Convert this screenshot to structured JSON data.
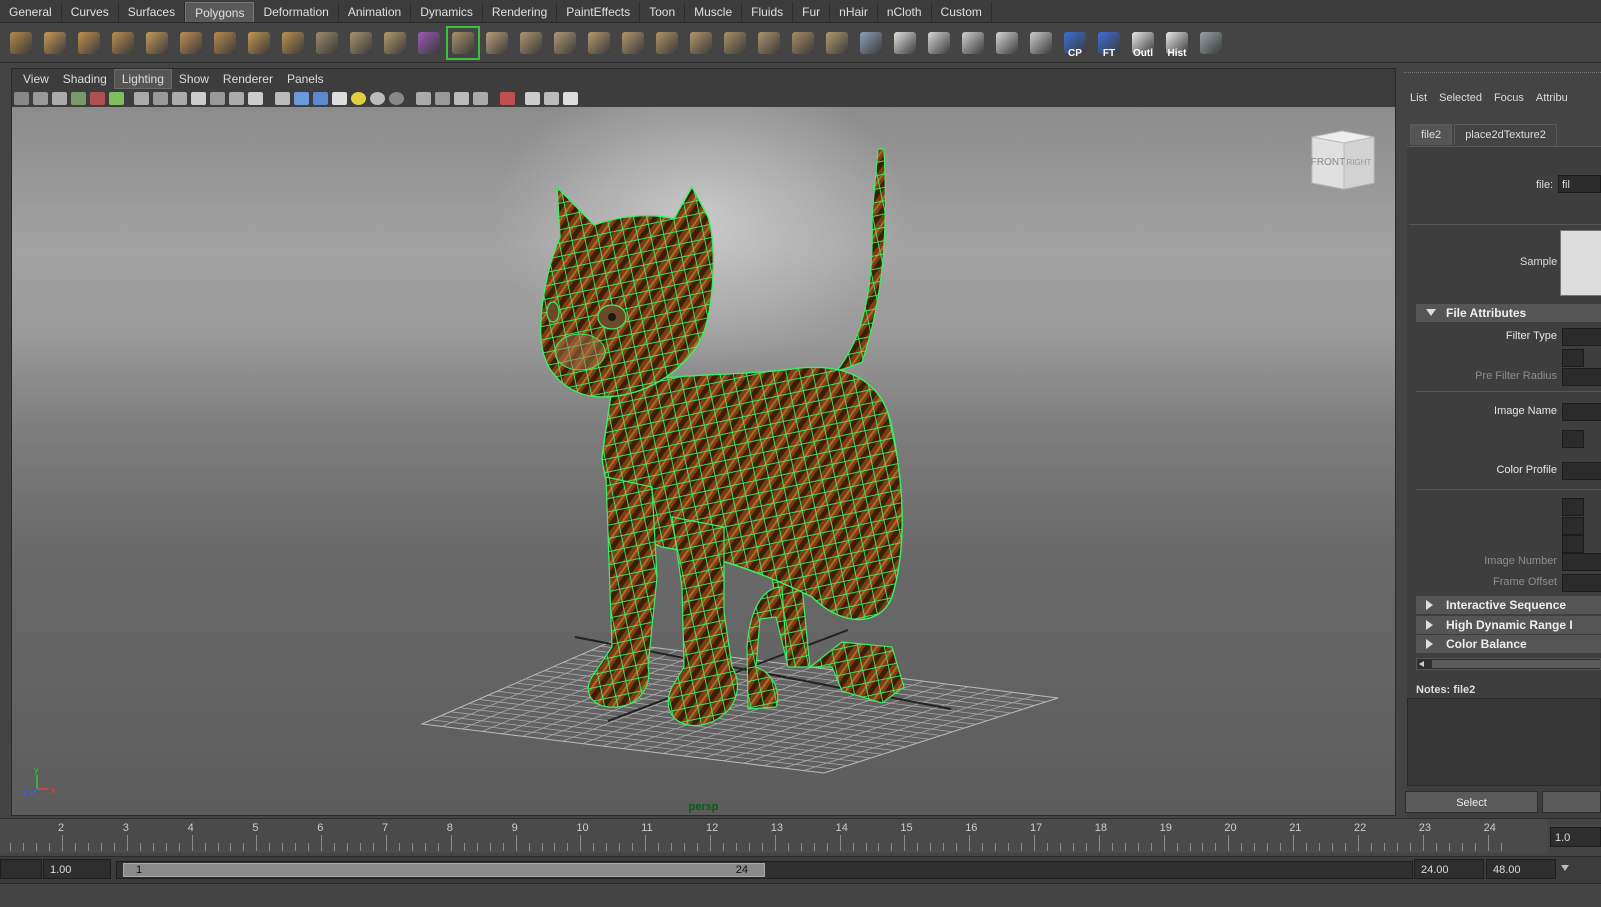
{
  "shelf": {
    "tabs": [
      {
        "label": "General",
        "active": false
      },
      {
        "label": "Curves",
        "active": false
      },
      {
        "label": "Surfaces",
        "active": false
      },
      {
        "label": "Polygons",
        "active": true
      },
      {
        "label": "Deformation",
        "active": false
      },
      {
        "label": "Animation",
        "active": false
      },
      {
        "label": "Dynamics",
        "active": false
      },
      {
        "label": "Rendering",
        "active": false
      },
      {
        "label": "PaintEffects",
        "active": false
      },
      {
        "label": "Toon",
        "active": false
      },
      {
        "label": "Muscle",
        "active": false
      },
      {
        "label": "Fluids",
        "active": false
      },
      {
        "label": "Fur",
        "active": false
      },
      {
        "label": "nHair",
        "active": false
      },
      {
        "label": "nCloth",
        "active": false
      },
      {
        "label": "Custom",
        "active": false
      }
    ],
    "icons": [
      {
        "name": "poly-sphere-icon",
        "color": "#b58a4a",
        "text": ""
      },
      {
        "name": "poly-cube-icon",
        "color": "#c89a55",
        "text": ""
      },
      {
        "name": "poly-cylinder-icon",
        "color": "#c0914c",
        "text": ""
      },
      {
        "name": "poly-cone-icon",
        "color": "#b88c4f",
        "text": ""
      },
      {
        "name": "poly-plane-icon",
        "color": "#c39a5a",
        "text": ""
      },
      {
        "name": "poly-torus-icon",
        "color": "#bf8e50",
        "text": ""
      },
      {
        "name": "poly-pyramid-icon",
        "color": "#b88a4d",
        "text": ""
      },
      {
        "name": "poly-pipe-icon",
        "color": "#c4964f",
        "text": ""
      },
      {
        "name": "poly-soccer-ball-icon",
        "color": "#bd914f",
        "text": ""
      },
      {
        "name": "combine-icon",
        "color": "#9a8a6a",
        "text": ""
      },
      {
        "name": "separate-icon",
        "color": "#a7946c",
        "text": ""
      },
      {
        "name": "smooth-icon",
        "color": "#b29a6a",
        "text": ""
      },
      {
        "name": "extrude-icon",
        "color": "#9b59b6",
        "text": ""
      },
      {
        "name": "bridge-icon",
        "color": "#a9906a",
        "text": ""
      },
      {
        "name": "append-polygon-icon",
        "color": "#b8a07a",
        "text": ""
      },
      {
        "name": "insert-edge-loop-icon",
        "color": "#ae9670",
        "text": ""
      },
      {
        "name": "split-polygon-icon",
        "color": "#b09a74",
        "text": ""
      },
      {
        "name": "bevel-icon",
        "color": "#b4996c",
        "text": ""
      },
      {
        "name": "merge-vertex-icon",
        "color": "#b2956a",
        "text": ""
      },
      {
        "name": "delete-edge-icon",
        "color": "#b09366",
        "text": ""
      },
      {
        "name": "fill-hole-icon",
        "color": "#b3976b",
        "text": ""
      },
      {
        "name": "planar-mapping-icon",
        "color": "#a88f66",
        "text": ""
      },
      {
        "name": "cylindrical-mapping-icon",
        "color": "#ad946a",
        "text": ""
      },
      {
        "name": "spherical-mapping-icon",
        "color": "#a78c64",
        "text": ""
      },
      {
        "name": "automatic-mapping-icon",
        "color": "#b29a70",
        "text": ""
      },
      {
        "name": "uv-snapshot-icon",
        "color": "#8da0b8",
        "text": ""
      },
      {
        "name": "checker-uv-icon",
        "color": "#e0e0e0",
        "text": ""
      },
      {
        "name": "checker-tile-icon",
        "color": "#d8d8d8",
        "text": ""
      },
      {
        "name": "checker-warp-icon",
        "color": "#d0d0d0",
        "text": ""
      },
      {
        "name": "checker-unfold-icon",
        "color": "#d5d5d5",
        "text": ""
      },
      {
        "name": "checker-board-icon",
        "color": "#cccccc",
        "text": ""
      },
      {
        "name": "center-pivot-icon",
        "color": "#3d6ed6",
        "text": "CP"
      },
      {
        "name": "freeze-transform-icon",
        "color": "#3d6ed6",
        "text": "FT"
      },
      {
        "name": "outliner-icon",
        "color": "#e8e8e8",
        "text": "Outl"
      },
      {
        "name": "history-icon",
        "color": "#e8e8e8",
        "text": "Hist"
      },
      {
        "name": "layer-icon",
        "color": "#9aa3a8",
        "text": ""
      }
    ]
  },
  "viewport": {
    "menus": [
      "View",
      "Shading",
      "Lighting",
      "Show",
      "Renderer",
      "Panels"
    ],
    "active_menu": "Lighting",
    "camera_label": "persp",
    "view_cube": {
      "front": "FRONT",
      "right": "RIGHT"
    },
    "axis": {
      "x": "x",
      "y": "y",
      "z": "z"
    }
  },
  "attribute_editor": {
    "menus": [
      "List",
      "Selected",
      "Focus",
      "Attribu"
    ],
    "tabs": [
      "file2",
      "place2dTexture2"
    ],
    "file_label": "file:",
    "file_value": "fil",
    "sample_label": "Sample",
    "frames": [
      {
        "label": "File Attributes",
        "expanded": true
      },
      {
        "label": "Interactive Sequence",
        "expanded": false
      },
      {
        "label": "High Dynamic Range I",
        "expanded": false
      },
      {
        "label": "Color Balance",
        "expanded": false
      }
    ],
    "attributes": {
      "filter_type": "Filter Type",
      "pre_filter_radius": "Pre Filter Radius",
      "image_name": "Image Name",
      "color_profile": "Color Profile",
      "image_number": "Image Number",
      "frame_offset": "Frame Offset"
    },
    "notes_label": "Notes:  file2",
    "select_button": "Select"
  },
  "timeline": {
    "ticks": [
      "2",
      "3",
      "4",
      "5",
      "6",
      "7",
      "8",
      "9",
      "10",
      "11",
      "12",
      "13",
      "14",
      "15",
      "16",
      "17",
      "18",
      "19",
      "20",
      "21",
      "22",
      "23",
      "24"
    ],
    "current_frame": "1.0",
    "start_time": "1.00",
    "range_start": "1",
    "range_end": "24",
    "playback_end": "24.00",
    "end_time": "48.00"
  }
}
